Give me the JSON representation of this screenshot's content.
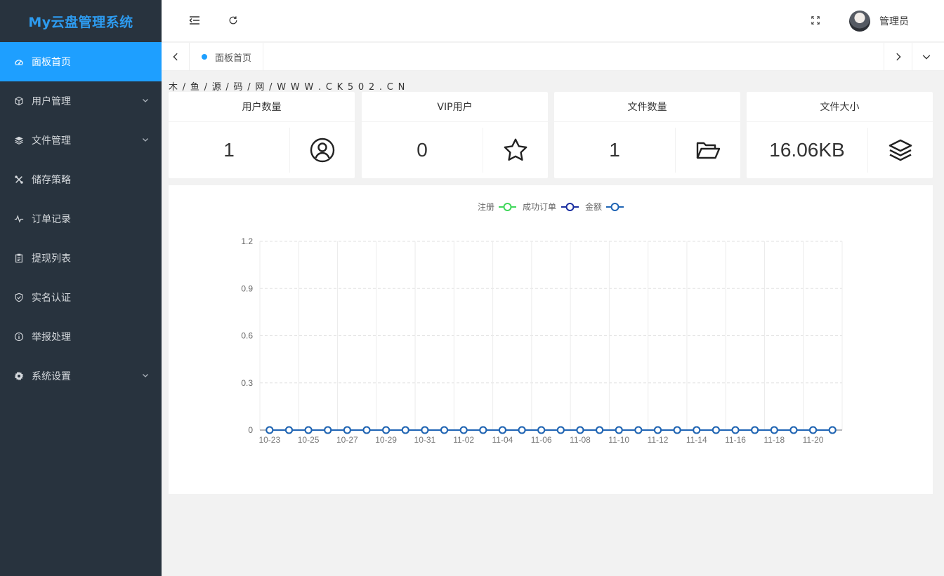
{
  "app": {
    "title": "My云盘管理系统"
  },
  "sidebar": {
    "items": [
      {
        "label": "面板首页",
        "icon": "dashboard-icon",
        "active": true,
        "expandable": false
      },
      {
        "label": "用户管理",
        "icon": "cube-icon",
        "active": false,
        "expandable": true
      },
      {
        "label": "文件管理",
        "icon": "layers-icon",
        "active": false,
        "expandable": true
      },
      {
        "label": "储存策略",
        "icon": "tools-icon",
        "active": false,
        "expandable": false
      },
      {
        "label": "订单记录",
        "icon": "pulse-icon",
        "active": false,
        "expandable": false
      },
      {
        "label": "提现列表",
        "icon": "clipboard-icon",
        "active": false,
        "expandable": false
      },
      {
        "label": "实名认证",
        "icon": "shield-icon",
        "active": false,
        "expandable": false
      },
      {
        "label": "举报处理",
        "icon": "info-icon",
        "active": false,
        "expandable": false
      },
      {
        "label": "系统设置",
        "icon": "gear-icon",
        "active": false,
        "expandable": true
      }
    ]
  },
  "header": {
    "username": "管理员"
  },
  "tabs": {
    "home_label": "面板首页"
  },
  "breadcrumb": {
    "text": "木 / 鱼 / 源 / 码 / 网 / W W W . C K 5 0 2 . C N"
  },
  "stats": [
    {
      "title": "用户数量",
      "value": "1",
      "icon": "user-circle-icon"
    },
    {
      "title": "VIP用户",
      "value": "0",
      "icon": "star-icon"
    },
    {
      "title": "文件数量",
      "value": "1",
      "icon": "folder-open-icon"
    },
    {
      "title": "文件大小",
      "value": "16.06KB",
      "icon": "layers-icon"
    }
  ],
  "colors": {
    "sidebar_bg": "#28333e",
    "accent": "#1e9fff",
    "logo": "#2d9bef"
  },
  "chart_data": {
    "type": "line",
    "legend_position": "top-center",
    "grid": true,
    "ylim": [
      0,
      1.2
    ],
    "yticks": [
      "1.2",
      "0.9",
      "0.6",
      "0.3",
      "0"
    ],
    "x": [
      "10-23",
      "10-24",
      "10-25",
      "10-26",
      "10-27",
      "10-28",
      "10-29",
      "10-30",
      "10-31",
      "11-01",
      "11-02",
      "11-03",
      "11-04",
      "11-05",
      "11-06",
      "11-07",
      "11-08",
      "11-09",
      "11-10",
      "11-11",
      "11-12",
      "11-13",
      "11-14",
      "11-15",
      "11-16",
      "11-17",
      "11-18",
      "11-19",
      "11-20",
      "11-21"
    ],
    "xtick_labels": [
      "10-23",
      "10-25",
      "10-27",
      "10-29",
      "10-31",
      "11-02",
      "11-04",
      "11-06",
      "11-08",
      "11-10",
      "11-12",
      "11-14",
      "11-16",
      "11-18",
      "11-20"
    ],
    "series": [
      {
        "name": "注册",
        "color": "#3fd75a",
        "values": [
          0,
          0,
          0,
          0,
          0,
          0,
          0,
          0,
          0,
          0,
          0,
          0,
          0,
          0,
          0,
          0,
          0,
          0,
          0,
          0,
          0,
          0,
          0,
          0,
          0,
          0,
          0,
          0,
          0,
          0
        ]
      },
      {
        "name": "成功订单",
        "color": "#1a2ea0",
        "values": [
          0,
          0,
          0,
          0,
          0,
          0,
          0,
          0,
          0,
          0,
          0,
          0,
          0,
          0,
          0,
          0,
          0,
          0,
          0,
          0,
          0,
          0,
          0,
          0,
          0,
          0,
          0,
          0,
          0,
          0
        ]
      },
      {
        "name": "金额",
        "color": "#1f64b4",
        "values": [
          0,
          0,
          0,
          0,
          0,
          0,
          0,
          0,
          0,
          0,
          0,
          0,
          0,
          0,
          0,
          0,
          0,
          0,
          0,
          0,
          0,
          0,
          0,
          0,
          0,
          0,
          0,
          0,
          0,
          0
        ]
      }
    ]
  }
}
